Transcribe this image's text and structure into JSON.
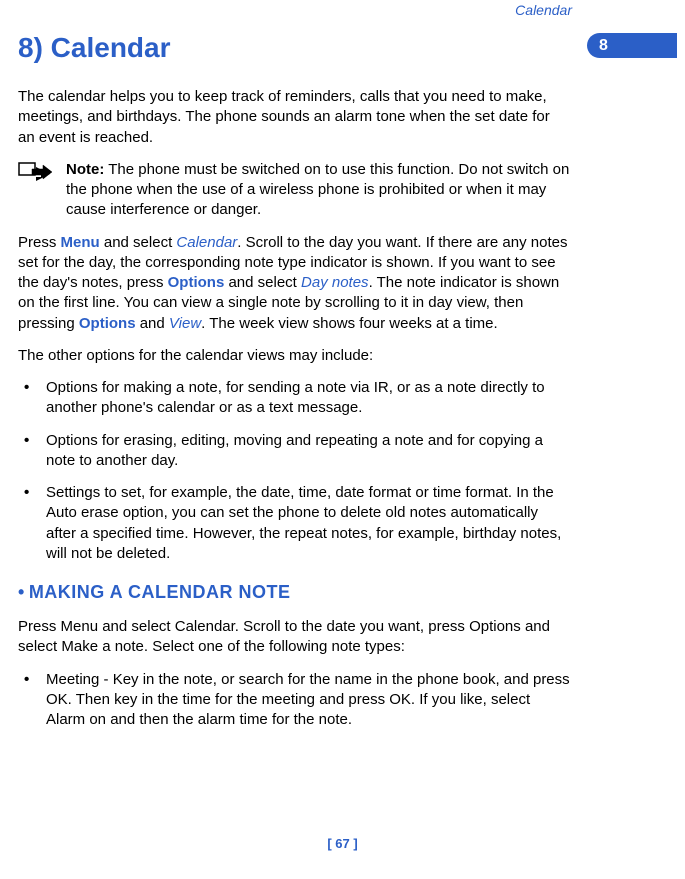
{
  "header": {
    "section_name": "Calendar",
    "tab_number": "8"
  },
  "chapter": {
    "title": "8) Calendar"
  },
  "intro": "The calendar helps you to keep track of reminders, calls that you need to make, meetings, and birthdays. The phone sounds an alarm tone when the set date for an event is reached.",
  "note": {
    "label": "Note:",
    "text": " The phone must be switched on to use this function. Do not switch on the phone when the use of a wireless phone is prohibited or when it may cause interference or danger."
  },
  "nav_para": {
    "p1": "Press ",
    "menu": "Menu",
    "p2": " and select ",
    "calendar": "Calendar",
    "p3": ". Scroll to the day you want. If there are any notes set for the day, the corresponding note type indicator is shown. If you want to see the day's notes, press ",
    "options1": "Options",
    "p4": " and select ",
    "daynotes": "Day notes",
    "p5": ". The note indicator is shown on the first line. You can view a single note by scrolling to it in day view, then pressing ",
    "options2": "Options",
    "p6": " and ",
    "view": "View",
    "p7": ". The week view shows four weeks at a time."
  },
  "options_intro": "The other options for the calendar views may include:",
  "options_list": [
    "Options for making a note, for sending a note via IR, or as a note directly to another phone's calendar or as a text message.",
    "Options for erasing, editing, moving and repeating a note and for copying a note to another day.",
    "Settings to set, for example, the date, time, date format or time format. In the Auto erase option, you can set the phone to delete old notes automatically after a specified time. However, the repeat notes, for example, birthday notes, will not be deleted."
  ],
  "section2": {
    "bullet": " •",
    "title": "MAKING A CALENDAR NOTE",
    "intro": "Press Menu and select Calendar. Scroll to the date you want, press Options and select Make a note. Select one of the following note types:",
    "list": [
      "Meeting - Key in the note, or search for the name in the phone book, and press OK. Then key in the time for the meeting and press OK. If you like, select Alarm on and then the alarm time for the note."
    ]
  },
  "footer": {
    "page": "[ 67 ]"
  }
}
